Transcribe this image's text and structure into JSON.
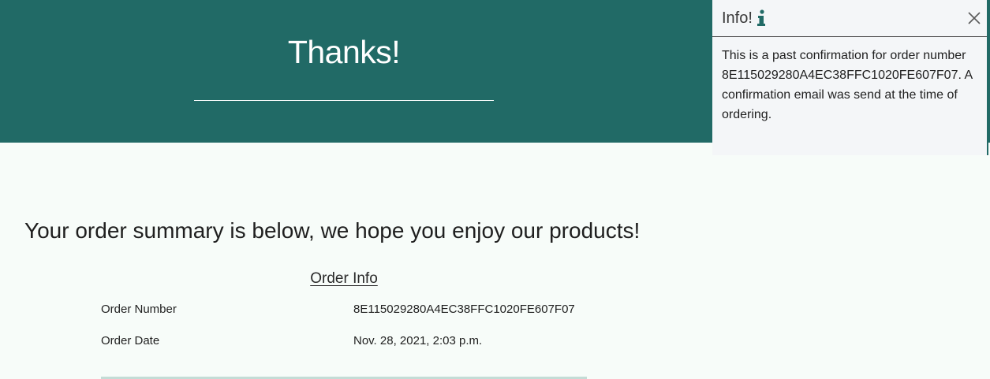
{
  "hero": {
    "title": "Thanks!"
  },
  "main": {
    "summary_heading": "Your order summary is below, we hope you enjoy our products!",
    "order_info": {
      "section_title": "Order Info",
      "rows": [
        {
          "label": "Order Number",
          "value": "8E115029280A4EC38FFC1020FE607F07"
        },
        {
          "label": "Order Date",
          "value": "Nov. 28, 2021, 2:03 p.m."
        }
      ]
    }
  },
  "toast": {
    "title": "Info!",
    "icon": "info-icon",
    "close_icon": "close-icon",
    "message": "This is a past confirmation for order number 8E115029280A4EC38FFC1020FE607F07. A confirmation email was send at the time of ordering."
  },
  "colors": {
    "brand": "#216a66",
    "page_background": "#f7fcf9",
    "toast_background": "#f4f6f8",
    "divider": "#c4dcd6"
  }
}
